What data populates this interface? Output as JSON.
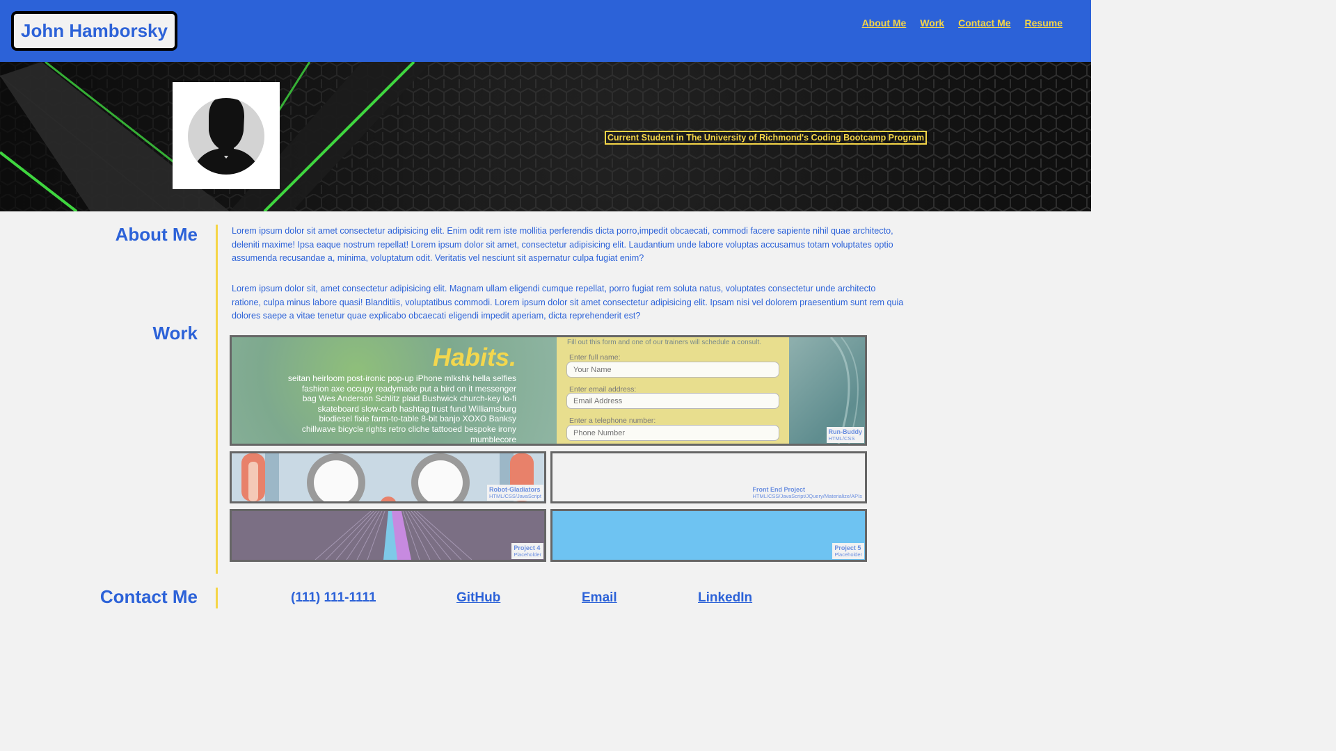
{
  "header": {
    "brand": "John Hamborsky",
    "nav": [
      "About Me",
      "Work",
      "Contact Me",
      "Resume"
    ]
  },
  "hero": {
    "tagline": "Current Student in The University of Richmond's Coding Bootcamp Program"
  },
  "about": {
    "title": "About Me",
    "paragraphs": [
      "Lorem ipsum dolor sit amet consectetur adipisicing elit. Enim odit rem iste mollitia perferendis dicta porro,impedit obcaecati, commodi facere sapiente nihil quae architecto, deleniti maxime! Ipsa eaque nostrum repellat! Lorem ipsum dolor sit amet, consectetur adipisicing elit. Laudantium unde labore voluptas accusamus totam voluptates optio assumenda recusandae a, minima, voluptatum odit. Veritatis vel nesciunt sit aspernatur culpa fugiat enim?",
      "Lorem ipsum dolor sit, amet consectetur adipisicing elit. Magnam ullam eligendi cumque repellat, porro fugiat rem soluta natus, voluptates consectetur unde architecto ratione, culpa minus labore quasi! Blanditiis, voluptatibus commodi. Lorem ipsum dolor sit amet consectetur adipisicing elit. Ipsam nisi vel dolorem praesentium sunt rem quia dolores saepe a vitae tenetur quae explicabo obcaecati eligendi impedit aperiam, dicta reprehenderit est?"
    ]
  },
  "work": {
    "title": "Work",
    "run_buddy": {
      "habits": "Habits.",
      "copy": "seitan heirloom post-ironic pop-up iPhone mlkshk hella selfies fashion axe occupy readymade put a bird on it messenger bag Wes Anderson Schlitz plaid Bushwick church-key lo-fi skateboard slow-carb hashtag trust fund Williamsburg biodiesel fixie farm-to-table 8-bit banjo XOXO Banksy chillwave bicycle rights retro cliche tattooed bespoke irony mumblecore",
      "form_hint": "Fill out this form and one of our trainers will schedule a consult.",
      "name_label": "Enter full name:",
      "name_placeholder": "Your Name",
      "email_label": "Enter email address:",
      "email_placeholder": "Email Address",
      "phone_label": "Enter a telephone number:",
      "phone_placeholder": "Phone Number"
    },
    "projects": [
      {
        "title": "Run-Buddy",
        "tech": "HTML/CSS"
      },
      {
        "title": "Robot-Gladiators",
        "tech": "HTML/CSS/JavaScript"
      },
      {
        "title": "Front End Project",
        "tech": "HTML/CSS/JavaScript/JQuery/Materialize/APIs"
      },
      {
        "title": "Project 4",
        "tech": "Placeholder"
      },
      {
        "title": "Project 5",
        "tech": "Placeholder"
      }
    ]
  },
  "contact": {
    "title": "Contact Me",
    "phone": "(111) 111-1111",
    "links": [
      "GitHub",
      "Email",
      "LinkedIn"
    ]
  }
}
